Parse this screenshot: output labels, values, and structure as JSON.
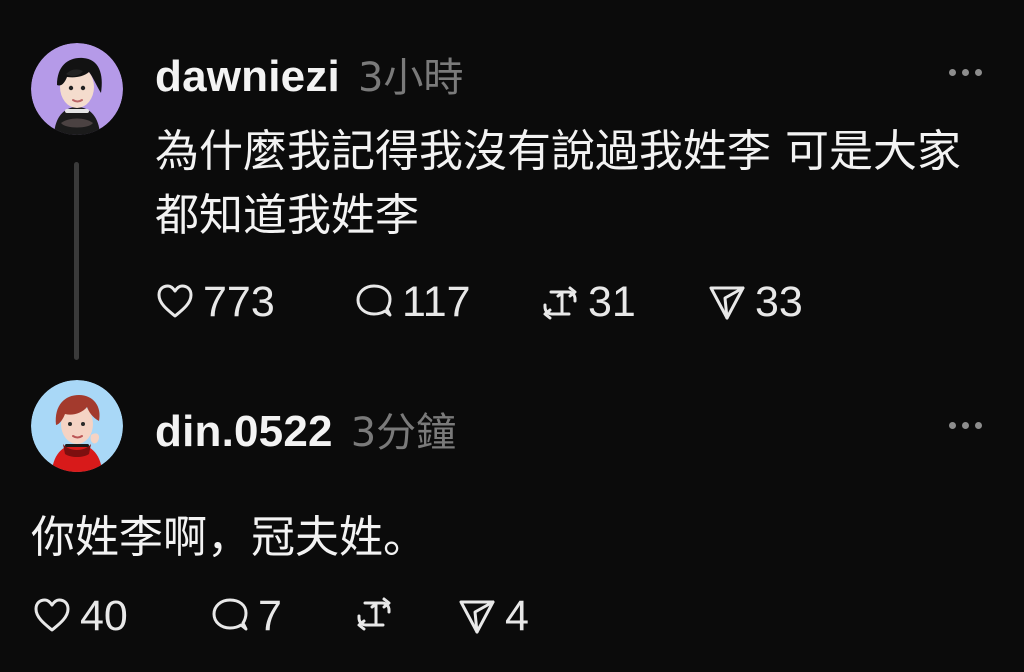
{
  "posts": [
    {
      "username": "dawniezi",
      "time": "3小時",
      "text": "為什麼我記得我沒有說過我姓李 可是大家都知道我姓李",
      "avatar_icon": "avatar-dark-hair-girl",
      "more_icon": "more-icon",
      "stats": {
        "likes": "773",
        "replies": "117",
        "reposts": "31",
        "shares": "33"
      }
    },
    {
      "username": "din.0522",
      "time": "3分鐘",
      "text": "你姓李啊，冠夫姓。",
      "avatar_icon": "avatar-red-hair-boy",
      "more_icon": "more-icon",
      "stats": {
        "likes": "40",
        "replies": "7",
        "reposts": "",
        "shares": "4"
      }
    }
  ],
  "icons": {
    "like": "heart-icon",
    "reply": "comment-icon",
    "repost": "repost-icon",
    "share": "send-icon"
  },
  "colors": {
    "background": "#0b0b0b",
    "text": "#f3f3f3",
    "muted": "#7a7a7a",
    "thread_line": "#3a3a3a",
    "avatar1_bg": "#b59ae8",
    "avatar2_bg": "#a9d8f7"
  }
}
